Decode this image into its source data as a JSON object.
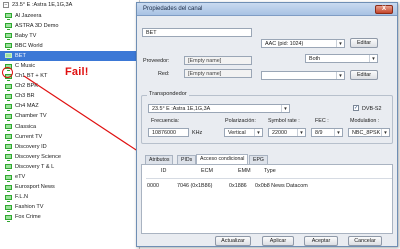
{
  "channel_list": {
    "satellite": "23.5° E :Astra 1E,1G,3A",
    "channels": [
      "Al Jazeera",
      "ASTRA 3D Demo",
      "Baby TV",
      "BBC World",
      "BET",
      "C Music",
      "Ch1 BT + KT",
      "Ch2 BPK",
      "Ch3 BR",
      "Ch4 MAZ",
      "Chamber TV",
      "Classica",
      "Current TV",
      "Discovery ID",
      "Discovery Science",
      "Discovery T & L",
      "eTV",
      "Eurosport News",
      "F.L.N",
      "Fashion TV",
      "Fox Crime"
    ],
    "selected_index": 4,
    "annotation": "Fail!"
  },
  "dialog": {
    "title": "Propiedades del canal",
    "close_label": "X",
    "name_value": "BET",
    "provider_label": "Proveedor:",
    "provider_value": "[Empty name]",
    "network_label": "Red:",
    "network_value": "[Empty name]",
    "audio_select": "AAC  (pid: 1024)",
    "audio_mode": "Both",
    "edit_label": "Editar",
    "edit_label_2": "Editar",
    "transponder_section": "Transpondedor",
    "transponder_select": "23.5° E :Astra 1E,1G,3A",
    "dvbs2_label": "DVB-S2",
    "dvbs2_checked": true,
    "frequency_label": "Frecuencia:",
    "frequency_value": "10876000",
    "frequency_unit": "KHz",
    "polarization_label": "Polarización:",
    "polarization_value": "Vertical",
    "symbol_rate_label": "Symbol rate :",
    "symbol_rate_value": "22000",
    "fec_label": "FEC :",
    "fec_value": "8/9",
    "modulation_label": "Modulation :",
    "modulation_value": "NBC_8PSK",
    "tabs": [
      "Atributos",
      "PIDs",
      "Acceso condicional",
      "EPG"
    ],
    "active_tab": 2,
    "cas_table": {
      "headers": [
        "ID",
        "ECM",
        "EMM",
        "Type"
      ],
      "rows": [
        [
          "0000",
          "7046 (0x1B86)",
          "0x1886",
          "0x0b8 News Datacom"
        ]
      ]
    },
    "buttons": {
      "update": "Actualizar",
      "apply": "Aplicar",
      "accept": "Aceptar",
      "cancel": "Cancelar"
    }
  }
}
